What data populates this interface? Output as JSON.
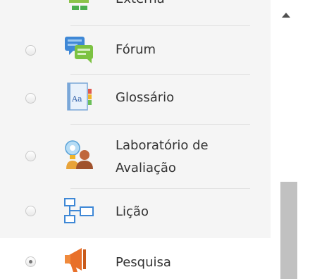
{
  "activities": [
    {
      "label": "Externa",
      "icon": "external-tool-icon",
      "selected": false
    },
    {
      "label": "Fórum",
      "icon": "forum-icon",
      "selected": false
    },
    {
      "label": "Glossário",
      "icon": "glossary-icon",
      "selected": false
    },
    {
      "label_line1": "Laboratório de",
      "label_line2": "Avaliação",
      "icon": "workshop-icon",
      "selected": false
    },
    {
      "label": "Lição",
      "icon": "lesson-icon",
      "selected": false
    },
    {
      "label": "Pesquisa",
      "icon": "survey-icon",
      "selected": true
    }
  ],
  "colors": {
    "list_background": "#f5f5f5",
    "selected_background": "#ffffff",
    "text": "#333333",
    "scroll_thumb": "#c1c1c1"
  }
}
